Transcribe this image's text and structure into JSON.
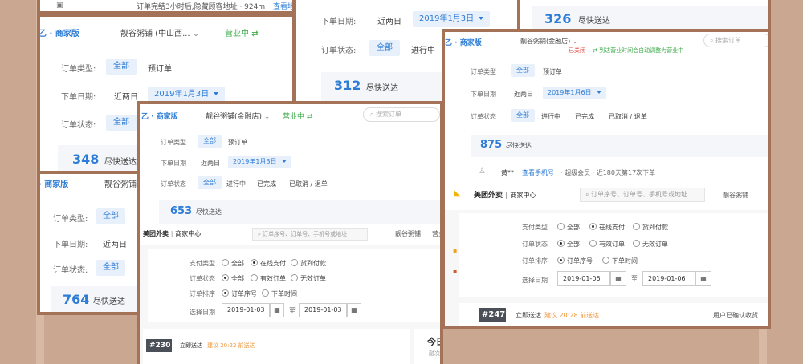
{
  "colors": {
    "brand": "#2d7cd6",
    "frame": "#a47256",
    "green": "#3caa4a",
    "red": "#e04a3d",
    "background": "#c9a791"
  },
  "labels": {
    "order_type": "订单类型:",
    "order_date": "下单日期:",
    "order_status": "订单状态:",
    "order_type_short": "订单类型",
    "order_date_short": "下单日期",
    "order_status_short": "订单状态",
    "all": "全部",
    "preorder": "预订单",
    "last_two_days": "近两日",
    "in_progress": "进行中",
    "completed": "已完成",
    "cancelled": "已取消 / 退单",
    "asap": "尽快送达",
    "business_open": "营业中",
    "merchant": "商家版"
  },
  "card_top_strip": {
    "text": "订单完结3小时后,隐藏顾客地址 · 924m",
    "link": "查看地"
  },
  "card_a": {
    "store": "靓谷粥铺 (中山西...",
    "date": "2019年1月3日",
    "count": "348"
  },
  "card_b": {
    "date": "2019年1月3日",
    "count": "312"
  },
  "card_c": {
    "count": "326"
  },
  "card_d": {
    "store": "靓谷粥铺",
    "count": "764"
  },
  "card_e": {
    "store": "靓谷粥铺(金融店)",
    "search": "搜索订单",
    "date": "2019年1月3日",
    "count": "653",
    "mt_brand": "美团外卖",
    "mt_center": "商家中心",
    "mt_search": "订单序号、订单号、手机号或地址",
    "mt_store": "靓谷粥铺",
    "mt_open": "营业",
    "pay_label": "支付类型",
    "pay_all": "全部",
    "pay_online": "在线支付",
    "pay_cod": "货到付款",
    "status_label": "订单状态",
    "status_all": "全部",
    "status_valid": "有效订单",
    "status_invalid": "无效订单",
    "sort_label": "订单排序",
    "sort_seq": "订单序号",
    "sort_time": "下单时间",
    "date_label": "选择日期",
    "date_from": "2019-01-03",
    "date_sep": "至",
    "date_to": "2019-01-03",
    "order_no": "#230",
    "order_mode": "立即送达",
    "order_hint": "建议 20:22 前送达",
    "today_title": "今日订",
    "today_sub": "融次)"
  },
  "card_f": {
    "store": "靓谷粥铺(金融店)",
    "search": "搜索订单",
    "closed": "已关闭",
    "auto_hint": "到达营业时间会自动调整为营业中",
    "date": "2019年1月6日",
    "count": "875",
    "customer": "黄**",
    "phone_link": "查看手机号",
    "customer_meta": "· 超级会员 · 近180天第17次下单",
    "mt_brand": "美团外卖",
    "mt_center": "商家中心",
    "mt_search": "订单序号、订单号、手机号或地址",
    "mt_store": "靓谷粥铺",
    "pay_label": "支付类型",
    "pay_all": "全部",
    "pay_online": "在线支付",
    "pay_cod": "货到付款",
    "status_label": "订单状态",
    "status_all": "全部",
    "status_valid": "有效订单",
    "status_invalid": "无效订单",
    "sort_label": "订单排序",
    "sort_seq": "订单序号",
    "sort_time": "下单时间",
    "date_label": "选择日期",
    "date_from": "2019-01-06",
    "date_sep": "至",
    "date_to": "2019-01-06",
    "order_no": "#247",
    "order_mode": "立即送达",
    "order_hint": "建议 20:28 前送达",
    "order_status": "用户已确认收货"
  }
}
